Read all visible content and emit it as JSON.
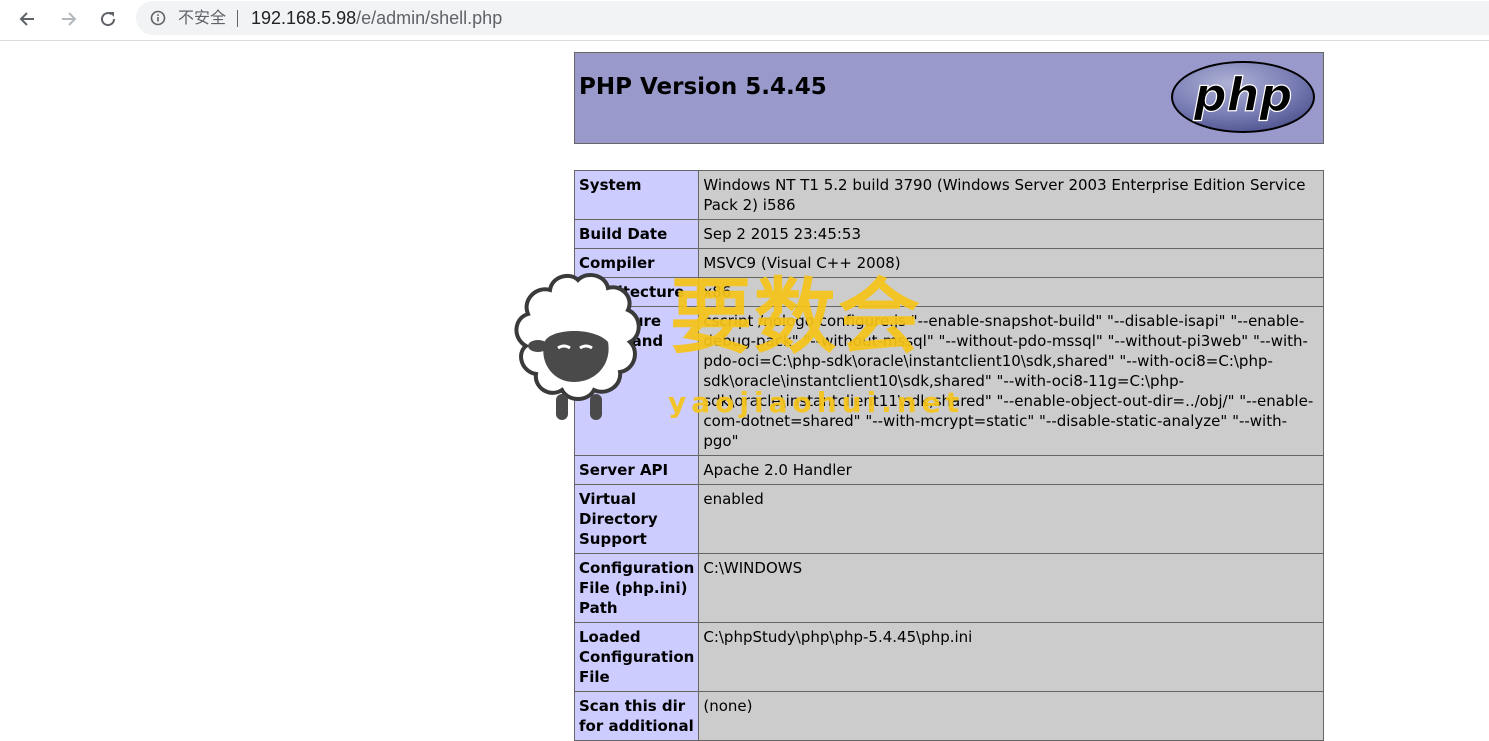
{
  "browser": {
    "security_label": "不安全",
    "url_host": "192.168.5.98",
    "url_path": "/e/admin/shell.php"
  },
  "phpinfo": {
    "title": "PHP Version 5.4.45",
    "logo_text": "php",
    "rows": [
      {
        "label": "System",
        "value": "Windows NT T1 5.2 build 3790 (Windows Server 2003 Enterprise Edition Service Pack 2) i586"
      },
      {
        "label": "Build Date",
        "value": "Sep 2 2015 23:45:53"
      },
      {
        "label": "Compiler",
        "value": "MSVC9 (Visual C++ 2008)"
      },
      {
        "label": "Architecture",
        "value": "x86"
      },
      {
        "label": "Configure Command",
        "value": "cscript /nologo configure.js \"--enable-snapshot-build\" \"--disable-isapi\" \"--enable-debug-pack\" \"--without-mssql\" \"--without-pdo-mssql\" \"--without-pi3web\" \"--with-pdo-oci=C:\\php-sdk\\oracle\\instantclient10\\sdk,shared\" \"--with-oci8=C:\\php-sdk\\oracle\\instantclient10\\sdk,shared\" \"--with-oci8-11g=C:\\php-sdk\\oracle\\instantclient11\\sdk,shared\" \"--enable-object-out-dir=../obj/\" \"--enable-com-dotnet=shared\" \"--with-mcrypt=static\" \"--disable-static-analyze\" \"--with-pgo\""
      },
      {
        "label": "Server API",
        "value": "Apache 2.0 Handler"
      },
      {
        "label": "Virtual Directory Support",
        "value": "enabled"
      },
      {
        "label": "Configuration File (php.ini) Path",
        "value": "C:\\WINDOWS"
      },
      {
        "label": "Loaded Configuration File",
        "value": "C:\\phpStudy\\php\\php-5.4.45\\php.ini"
      },
      {
        "label": "Scan this dir for additional",
        "value": "(none)"
      }
    ]
  },
  "watermark": {
    "text": "要数会",
    "subtext": "yaojiaohui.net"
  }
}
